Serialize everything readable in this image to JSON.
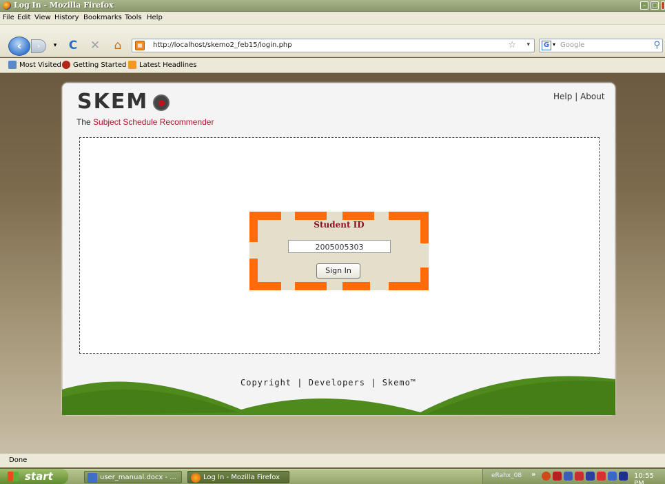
{
  "window": {
    "title": "Log In - Mozilla Firefox"
  },
  "menu": [
    "File",
    "Edit",
    "View",
    "History",
    "Bookmarks",
    "Tools",
    "Help"
  ],
  "nav": {
    "url": "http://localhost/skemo2_feb15/login.php",
    "search_placeholder": "Google"
  },
  "bookmarks": [
    "Most Visited",
    "Getting Started",
    "Latest Headlines"
  ],
  "page": {
    "logo": "SKEM",
    "tagline_prefix": "The ",
    "tagline_highlight": "Subject Schedule Recommender",
    "top_links": {
      "help": "Help",
      "sep": "|",
      "about": "About"
    },
    "login": {
      "label": "Student ID",
      "value": "2005005303",
      "button": "Sign In"
    },
    "footer": {
      "copyright": "Copyright",
      "developers": "Developers",
      "skemo": "Skemo™",
      "sep": "|"
    }
  },
  "status": {
    "text": "Done"
  },
  "taskbar": {
    "start": "start",
    "tasks": [
      "user_manual.docx - ...",
      "Log In - Mozilla Firefox"
    ],
    "tray_label": "eRahx_08",
    "clock": "10:55 PM"
  },
  "colors": {
    "accent_orange": "#ff6a0a",
    "brand_red": "#b2102a",
    "hill_green": "#4f8a1c"
  }
}
